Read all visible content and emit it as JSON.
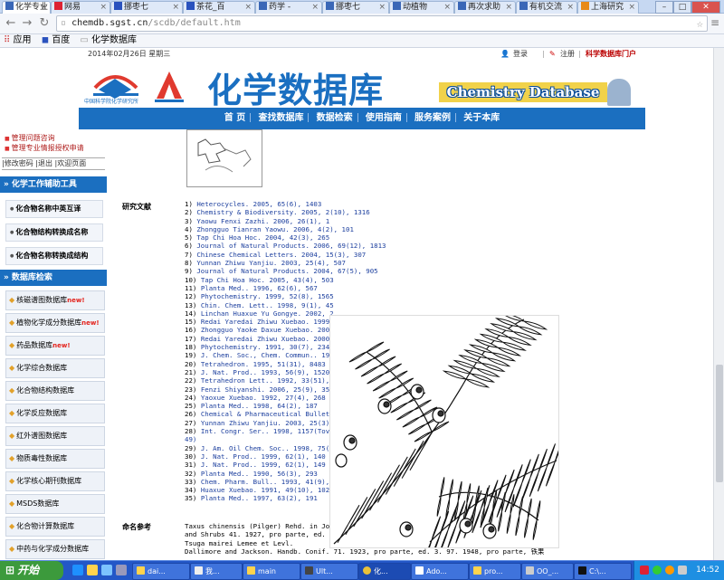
{
  "browser": {
    "tabs": [
      {
        "label": "化学专业",
        "active": true
      },
      {
        "label": "网易"
      },
      {
        "label": "挪枣七"
      },
      {
        "label": "茶花_百"
      },
      {
        "label": "药学 -"
      },
      {
        "label": "挪枣七"
      },
      {
        "label": "动植物"
      },
      {
        "label": "再次求助"
      },
      {
        "label": "有机交流"
      },
      {
        "label": "上海研究"
      }
    ],
    "url_host": "chemdb.sgst.cn",
    "url_path": "/scdb/default.htm",
    "bookmarks": [
      "应用",
      "百度",
      "化学数据库"
    ]
  },
  "header": {
    "date": "2014年02月26日 星期三",
    "login": "登录",
    "register": "注册",
    "portal": "科学数据库门户",
    "title_cn": "化学数据库",
    "title_en": "Chemistry Database",
    "logo1_text": "中国科学院化学研究所",
    "logo2_text": ""
  },
  "topnav": [
    "首 页",
    "查找数据库",
    "数据检索",
    "使用指南",
    "服务案例",
    "关于本库"
  ],
  "sidebar": {
    "links": [
      "管理问题咨询",
      "管理专业情报授权申请"
    ],
    "small_bar": [
      "|修改密码",
      "|退出",
      "|欢迎页面"
    ],
    "tools_header": "化学工作辅助工具",
    "tools": [
      "化合物名称中英互译",
      "化合物结构转换成名称",
      "化合物名称转换成结构"
    ],
    "db_header": "数据库检索",
    "new_label": "new!",
    "databases": [
      {
        "name": "核磁谱图数据库",
        "new": true
      },
      {
        "name": "植物化学成分数据库",
        "new": true
      },
      {
        "name": "药品数据库",
        "new": true
      },
      {
        "name": "化学综合数据库",
        "new": false
      },
      {
        "name": "化合物结构数据库",
        "new": false
      },
      {
        "name": "化学反应数据库",
        "new": false
      },
      {
        "name": "红外谱图数据库",
        "new": false
      },
      {
        "name": "物质毒性数据库",
        "new": false
      },
      {
        "name": "化学核心期刊数据库",
        "new": false
      },
      {
        "name": "MSDS数据库",
        "new": false
      },
      {
        "name": "化合物计算数据库",
        "new": false
      },
      {
        "name": "中药与化学成分数据库",
        "new": false
      }
    ]
  },
  "main": {
    "refs_label": "研究文献",
    "refs": [
      {
        "n": "1)",
        "t": "Heterocycles. 2005, 65(6), 1403"
      },
      {
        "n": "2)",
        "t": "Chemistry & Biodiversity. 2005, 2(10), 1316"
      },
      {
        "n": "3)",
        "t": "Yaowu Fenxi Zazhi. 2006, 26(1), 1"
      },
      {
        "n": "4)",
        "t": "Zhongguo Tianran Yaowu. 2006, 4(2), 101"
      },
      {
        "n": "5)",
        "t": "Tap Chi Hoa Hoc. 2004, 42(3), 265"
      },
      {
        "n": "6)",
        "t": "Journal of Natural Products. 2006, 69(12), 1813"
      },
      {
        "n": "7)",
        "t": "Chinese Chemical Letters. 2004, 15(3), 307"
      },
      {
        "n": "8)",
        "t": "Yunnan Zhiwu Yanjiu. 2003, 25(4), 507"
      },
      {
        "n": "9)",
        "t": "Journal of Natural Products. 2004, 67(5), 905"
      },
      {
        "n": "10)",
        "t": "Tap Chi Hoa Hoc. 2005, 43(4), 503"
      },
      {
        "n": "11)",
        "t": "Planta Med.. 1996, 62(6), 567"
      },
      {
        "n": "12)",
        "t": "Phytochemistry. 1999, 52(8), 1565"
      },
      {
        "n": "13)",
        "t": "Chin. Chem. Lett.. 1998, 9(1), 45"
      },
      {
        "n": "14)",
        "t": "Linchan Huaxue Yu Gongye. 2002, 2"
      },
      {
        "n": "15)",
        "t": "Redai Yaredai Zhiwu Xuebao. 1999,"
      },
      {
        "n": "16)",
        "t": "Zhongguo Yaoke Daxue Xuebao. 2001"
      },
      {
        "n": "17)",
        "t": "Redai Yaredai Zhiwu Xuebao. 2000,"
      },
      {
        "n": "18)",
        "t": "Phytochemistry. 1991, 30(7), 2345"
      },
      {
        "n": "19)",
        "t": "J. Chem. Soc., Chem. Commun.. 199"
      },
      {
        "n": "20)",
        "t": "Tetrahedron. 1995, 51(31), 8483"
      },
      {
        "n": "21)",
        "t": "J. Nat. Prod.. 1993, 56(9), 1520"
      },
      {
        "n": "22)",
        "t": "Tetrahedron Lett.. 1992, 33(51),"
      },
      {
        "n": "23)",
        "t": "Fenzi Shiyanshi. 2006, 25(9), 35"
      },
      {
        "n": "24)",
        "t": "Yaoxue Xuebao. 1992, 27(4), 268"
      },
      {
        "n": "25)",
        "t": "Planta Med.. 1998, 64(2), 187"
      },
      {
        "n": "26)",
        "t": "Chemical & Pharmaceutical Bulleti"
      },
      {
        "n": "27)",
        "t": "Yunnan Zhiwu Yanjiu. 2003, 25(3),"
      },
      {
        "n": "28)",
        "t": "Int. Congr. Ser.. 1998, 1157(Tova"
      },
      {
        "n": "",
        "t": "49)"
      },
      {
        "n": "29)",
        "t": "J. Am. Oil Chem. Soc.. 1998, 75(1"
      },
      {
        "n": "30)",
        "t": "J. Nat. Prod.. 1999, 62(1), 140"
      },
      {
        "n": "31)",
        "t": "J. Nat. Prod.. 1999, 62(1), 149"
      },
      {
        "n": "32)",
        "t": "Planta Med.. 1990, 56(3), 293"
      },
      {
        "n": "33)",
        "t": "Chem. Pharm. Bull.. 1993, 41(9),"
      },
      {
        "n": "34)",
        "t": "Huaxue Xuebao. 1991, 49(10), 1023"
      },
      {
        "n": "35)",
        "t": "Planta Med.. 1997, 63(2), 191"
      }
    ],
    "naming_label": "命名参考",
    "naming": [
      "Taxus chinensis (Pilger) Rehd. in Jou",
      "and Shrubs 41. 1927, pro parte, ed. 2",
      "Tsuga mairei Lemee et Levl.",
      "Dallimore and Jackson. Handb. Conif. 71. 1923, pro parte, ed. 3. 97. 1948, pro parte, 铁果"
    ]
  },
  "taskbar": {
    "start": "开始",
    "items": [
      "dai...",
      "我...",
      "main",
      "Ult...",
      "化...",
      "Ado...",
      "pro...",
      "OO_...",
      "C:\\..."
    ],
    "clock": "14:52"
  }
}
